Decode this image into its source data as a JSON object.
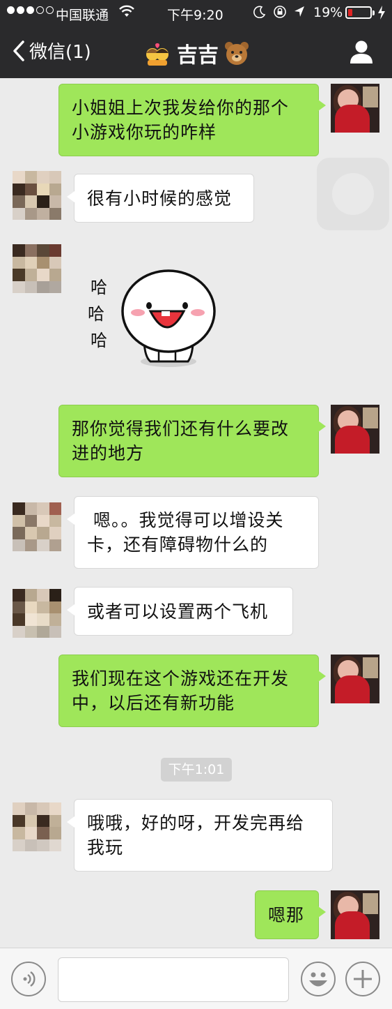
{
  "status_bar": {
    "carrier": "中国联通",
    "time": "下午9:20",
    "battery": "19%",
    "battery_level": 0.19,
    "signal_bars_filled": 3,
    "signal_bars_total": 5
  },
  "nav": {
    "back_label": "微信(1)",
    "title": "吉吉",
    "title_emoji_left": "couple-emoji",
    "title_emoji_right": "bear-face-emoji",
    "profile_icon": "person-icon"
  },
  "colors": {
    "outgoing_bubble": "#9fe65a",
    "incoming_bubble": "#ffffff",
    "nav_background": "#2a2a2c",
    "chat_background": "#ebebeb"
  },
  "messages": [
    {
      "direction": "out",
      "text": [
        "小姐姐上次我发给你的那个",
        "小游戏你玩的咋样"
      ]
    },
    {
      "direction": "in",
      "text": [
        "很有小时候的感觉"
      ]
    },
    {
      "direction": "in",
      "type": "sticker",
      "sticker_text": [
        "哈",
        "哈",
        "哈"
      ]
    },
    {
      "direction": "out",
      "text": [
        "那你觉得我们还有什么要改",
        "进的地方"
      ]
    },
    {
      "direction": "in",
      "text": [
        " 嗯。。我觉得可以增设关",
        "卡，还有障碍物什么的"
      ]
    },
    {
      "direction": "in",
      "text": [
        "或者可以设置两个飞机"
      ]
    },
    {
      "direction": "out",
      "text": [
        "我们现在这个游戏还在开发",
        "中，以后还有新功能"
      ]
    },
    {
      "direction": "in",
      "text": [
        "哦哦，好的呀，开发完再给",
        "我玩"
      ]
    },
    {
      "direction": "out",
      "text": [
        "嗯那"
      ]
    }
  ],
  "time_divider": "下午1:01",
  "input_bar": {
    "voice_icon": "voice-icon",
    "emoji_icon": "smiley-icon",
    "plus_icon": "plus-icon",
    "input_value": ""
  }
}
